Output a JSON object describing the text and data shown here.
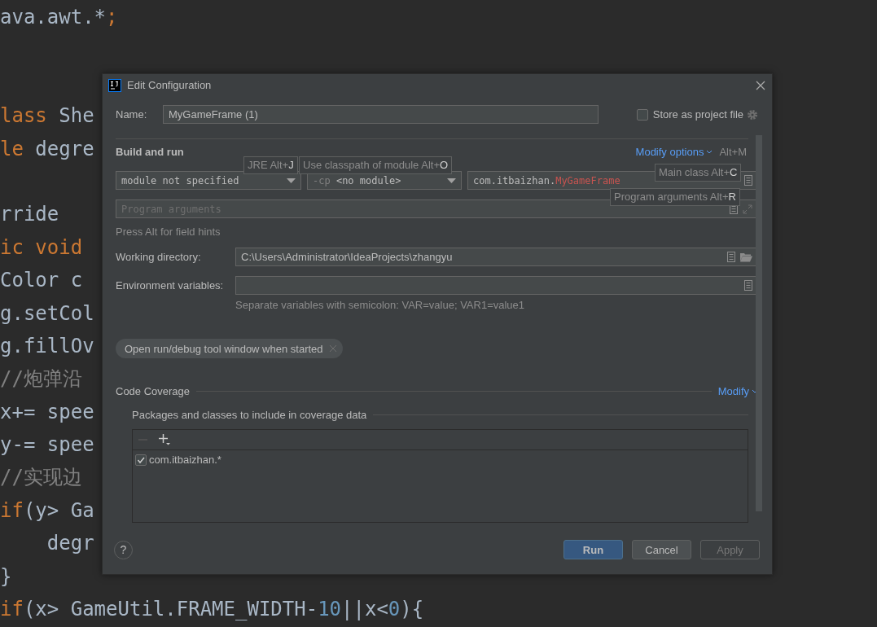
{
  "editor": {
    "lines": [
      {
        "kind": "code",
        "segments": [
          {
            "kind": "plain",
            "text": "ava.awt.*"
          },
          {
            "kind": "keyword",
            "text": ";"
          }
        ]
      },
      {
        "kind": "blank"
      },
      {
        "kind": "blank"
      },
      {
        "kind": "code",
        "segments": [
          {
            "kind": "keyword",
            "text": "lass "
          },
          {
            "kind": "plain",
            "text": "She"
          }
        ]
      },
      {
        "kind": "code",
        "segments": [
          {
            "kind": "keyword",
            "text": "le "
          },
          {
            "kind": "plain",
            "text": "degre"
          }
        ]
      },
      {
        "kind": "blank"
      },
      {
        "kind": "code",
        "segments": [
          {
            "kind": "plain",
            "text": "rride"
          }
        ]
      },
      {
        "kind": "code",
        "segments": [
          {
            "kind": "keyword",
            "text": "ic void"
          }
        ]
      },
      {
        "kind": "code",
        "segments": [
          {
            "kind": "plain",
            "text": "Color c"
          }
        ]
      },
      {
        "kind": "code",
        "segments": [
          {
            "kind": "plain",
            "text": "g.setCol"
          }
        ]
      },
      {
        "kind": "code",
        "segments": [
          {
            "kind": "plain",
            "text": "g.fillOv"
          }
        ]
      },
      {
        "kind": "code",
        "segments": [
          {
            "kind": "comment",
            "text": "//炮弹沿"
          }
        ]
      },
      {
        "kind": "code",
        "segments": [
          {
            "kind": "plain",
            "text": "x+= spee"
          }
        ]
      },
      {
        "kind": "code",
        "segments": [
          {
            "kind": "plain",
            "text": "y-= spee"
          }
        ]
      },
      {
        "kind": "code",
        "segments": [
          {
            "kind": "comment",
            "text": "//实现边"
          }
        ]
      },
      {
        "kind": "code",
        "segments": [
          {
            "kind": "keyword",
            "text": "if"
          },
          {
            "kind": "plain",
            "text": "(y> Ga"
          }
        ]
      },
      {
        "kind": "code",
        "segments": [
          {
            "kind": "plain",
            "text": "    degr"
          }
        ]
      },
      {
        "kind": "code",
        "segments": [
          {
            "kind": "plain",
            "text": "}"
          }
        ]
      },
      {
        "kind": "code",
        "segments": [
          {
            "kind": "keyword",
            "text": "if"
          },
          {
            "kind": "plain",
            "text": "(x> GameUtil.FRAME_WIDTH-"
          },
          {
            "kind": "number",
            "text": "10"
          },
          {
            "kind": "plain",
            "text": "||x<"
          },
          {
            "kind": "number",
            "text": "0"
          },
          {
            "kind": "plain",
            "text": "){"
          }
        ]
      }
    ]
  },
  "dialog": {
    "title": "Edit Configuration",
    "name_field": {
      "label": "Name:",
      "value": "MyGameFrame (1)"
    },
    "store_checkbox": {
      "label": "Store as project file",
      "checked": false
    },
    "build_and_run": {
      "title": "Build and run",
      "modify_link": "Modify options",
      "modify_shortcut": "Alt+M",
      "jre_select": {
        "value": "module not specified"
      },
      "cp_select": {
        "prefix": "-cp",
        "value": "<no module>"
      },
      "main_class": {
        "package": "com.itbaizhan.",
        "class_name": "MyGameFrame"
      },
      "program_args": {
        "placeholder": "Program arguments"
      },
      "hint": "Press Alt for field hints"
    },
    "field_hints": [
      {
        "kind": "jre",
        "text": "JRE Alt+**J**"
      },
      {
        "kind": "classpath",
        "text": "Use classpath of module Alt+**O**"
      },
      {
        "kind": "main_class",
        "text": "Main class Alt+**C**"
      },
      {
        "kind": "program_args",
        "text": "Program arguments Alt+**R**"
      }
    ],
    "working_directory": {
      "label": "Working directory:",
      "value": "C:\\Users\\Administrator\\IdeaProjects\\zhangyu"
    },
    "environment_variables": {
      "label": "Environment variables:",
      "help": "Separate variables with semicolon: VAR=value; VAR1=value1"
    },
    "options": [
      {
        "label": "Open run/debug tool window when started"
      }
    ],
    "code_coverage": {
      "title": "Code Coverage",
      "modify_link": "Modify",
      "packages_title": "Packages and classes to include in coverage data",
      "remove_disabled": true,
      "entries": [
        {
          "label": "com.itbaizhan.*",
          "checked": true
        }
      ]
    },
    "help": "?",
    "buttons": [
      {
        "label": "Run",
        "kind": "primary"
      },
      {
        "label": "Cancel",
        "kind": "secondary"
      },
      {
        "label": "Apply",
        "kind": "disabled"
      }
    ]
  }
}
